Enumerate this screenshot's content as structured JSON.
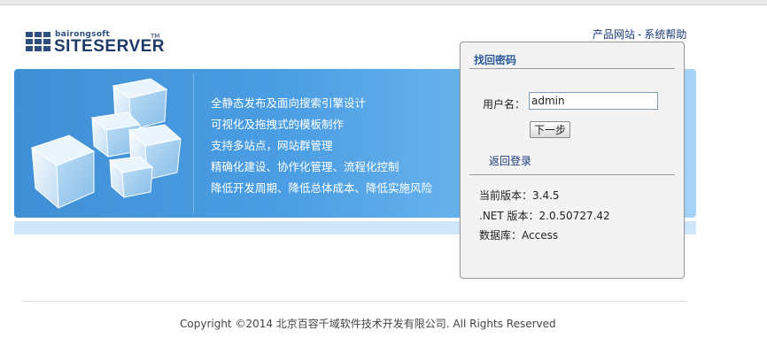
{
  "logo": {
    "small": "bairongsoft",
    "big": "SITESERVER",
    "tm": "TM"
  },
  "top_links": {
    "site": "产品网站",
    "separator": "-",
    "help": "系统帮助"
  },
  "features": [
    "全静态发布及面向搜索引擎设计",
    "可视化及拖拽式的模板制作",
    "支持多站点，网站群管理",
    "精确化建设、协作化管理、流程化控制",
    "降低开发周期、降低总体成本、降低实施风险"
  ],
  "panel": {
    "title": "找回密码",
    "username_label": "用户名：",
    "username_value": "admin",
    "next_button": "下一步",
    "back_link": "返回登录",
    "version": "当前版本：3.4.5",
    "net_version": ".NET 版本：2.0.50727.42",
    "database": "数据库：Access"
  },
  "footer": {
    "copyright": "Copyright ©2014 北京百容千域软件技术开发有限公司. All Rights Reserved"
  },
  "colors": {
    "banner_blue": "#4b9ee3",
    "link_blue": "#1a3a7a",
    "panel_title": "#2a5a9a"
  }
}
